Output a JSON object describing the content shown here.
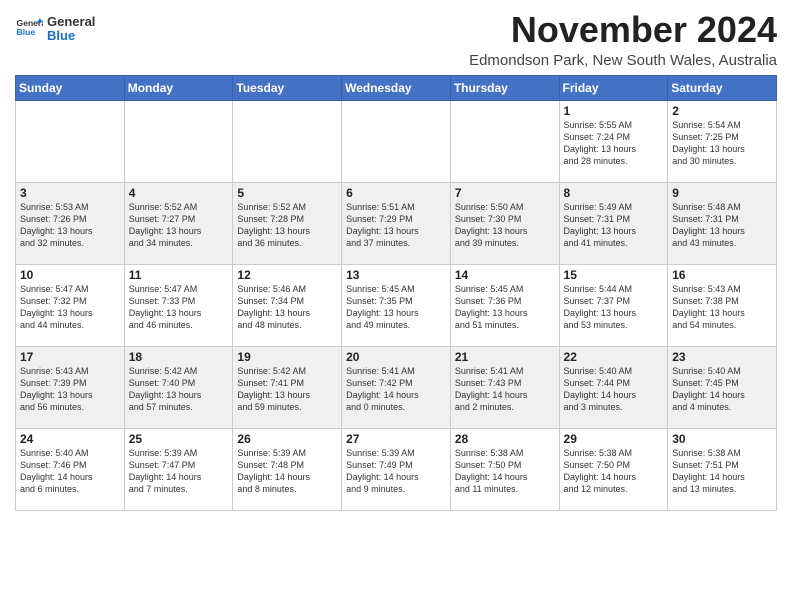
{
  "header": {
    "logo_general": "General",
    "logo_blue": "Blue",
    "month_title": "November 2024",
    "location": "Edmondson Park, New South Wales, Australia"
  },
  "days_of_week": [
    "Sunday",
    "Monday",
    "Tuesday",
    "Wednesday",
    "Thursday",
    "Friday",
    "Saturday"
  ],
  "weeks": [
    [
      {
        "day": "",
        "info": ""
      },
      {
        "day": "",
        "info": ""
      },
      {
        "day": "",
        "info": ""
      },
      {
        "day": "",
        "info": ""
      },
      {
        "day": "",
        "info": ""
      },
      {
        "day": "1",
        "info": "Sunrise: 5:55 AM\nSunset: 7:24 PM\nDaylight: 13 hours\nand 28 minutes."
      },
      {
        "day": "2",
        "info": "Sunrise: 5:54 AM\nSunset: 7:25 PM\nDaylight: 13 hours\nand 30 minutes."
      }
    ],
    [
      {
        "day": "3",
        "info": "Sunrise: 5:53 AM\nSunset: 7:26 PM\nDaylight: 13 hours\nand 32 minutes."
      },
      {
        "day": "4",
        "info": "Sunrise: 5:52 AM\nSunset: 7:27 PM\nDaylight: 13 hours\nand 34 minutes."
      },
      {
        "day": "5",
        "info": "Sunrise: 5:52 AM\nSunset: 7:28 PM\nDaylight: 13 hours\nand 36 minutes."
      },
      {
        "day": "6",
        "info": "Sunrise: 5:51 AM\nSunset: 7:29 PM\nDaylight: 13 hours\nand 37 minutes."
      },
      {
        "day": "7",
        "info": "Sunrise: 5:50 AM\nSunset: 7:30 PM\nDaylight: 13 hours\nand 39 minutes."
      },
      {
        "day": "8",
        "info": "Sunrise: 5:49 AM\nSunset: 7:31 PM\nDaylight: 13 hours\nand 41 minutes."
      },
      {
        "day": "9",
        "info": "Sunrise: 5:48 AM\nSunset: 7:31 PM\nDaylight: 13 hours\nand 43 minutes."
      }
    ],
    [
      {
        "day": "10",
        "info": "Sunrise: 5:47 AM\nSunset: 7:32 PM\nDaylight: 13 hours\nand 44 minutes."
      },
      {
        "day": "11",
        "info": "Sunrise: 5:47 AM\nSunset: 7:33 PM\nDaylight: 13 hours\nand 46 minutes."
      },
      {
        "day": "12",
        "info": "Sunrise: 5:46 AM\nSunset: 7:34 PM\nDaylight: 13 hours\nand 48 minutes."
      },
      {
        "day": "13",
        "info": "Sunrise: 5:45 AM\nSunset: 7:35 PM\nDaylight: 13 hours\nand 49 minutes."
      },
      {
        "day": "14",
        "info": "Sunrise: 5:45 AM\nSunset: 7:36 PM\nDaylight: 13 hours\nand 51 minutes."
      },
      {
        "day": "15",
        "info": "Sunrise: 5:44 AM\nSunset: 7:37 PM\nDaylight: 13 hours\nand 53 minutes."
      },
      {
        "day": "16",
        "info": "Sunrise: 5:43 AM\nSunset: 7:38 PM\nDaylight: 13 hours\nand 54 minutes."
      }
    ],
    [
      {
        "day": "17",
        "info": "Sunrise: 5:43 AM\nSunset: 7:39 PM\nDaylight: 13 hours\nand 56 minutes."
      },
      {
        "day": "18",
        "info": "Sunrise: 5:42 AM\nSunset: 7:40 PM\nDaylight: 13 hours\nand 57 minutes."
      },
      {
        "day": "19",
        "info": "Sunrise: 5:42 AM\nSunset: 7:41 PM\nDaylight: 13 hours\nand 59 minutes."
      },
      {
        "day": "20",
        "info": "Sunrise: 5:41 AM\nSunset: 7:42 PM\nDaylight: 14 hours\nand 0 minutes."
      },
      {
        "day": "21",
        "info": "Sunrise: 5:41 AM\nSunset: 7:43 PM\nDaylight: 14 hours\nand 2 minutes."
      },
      {
        "day": "22",
        "info": "Sunrise: 5:40 AM\nSunset: 7:44 PM\nDaylight: 14 hours\nand 3 minutes."
      },
      {
        "day": "23",
        "info": "Sunrise: 5:40 AM\nSunset: 7:45 PM\nDaylight: 14 hours\nand 4 minutes."
      }
    ],
    [
      {
        "day": "24",
        "info": "Sunrise: 5:40 AM\nSunset: 7:46 PM\nDaylight: 14 hours\nand 6 minutes."
      },
      {
        "day": "25",
        "info": "Sunrise: 5:39 AM\nSunset: 7:47 PM\nDaylight: 14 hours\nand 7 minutes."
      },
      {
        "day": "26",
        "info": "Sunrise: 5:39 AM\nSunset: 7:48 PM\nDaylight: 14 hours\nand 8 minutes."
      },
      {
        "day": "27",
        "info": "Sunrise: 5:39 AM\nSunset: 7:49 PM\nDaylight: 14 hours\nand 9 minutes."
      },
      {
        "day": "28",
        "info": "Sunrise: 5:38 AM\nSunset: 7:50 PM\nDaylight: 14 hours\nand 11 minutes."
      },
      {
        "day": "29",
        "info": "Sunrise: 5:38 AM\nSunset: 7:50 PM\nDaylight: 14 hours\nand 12 minutes."
      },
      {
        "day": "30",
        "info": "Sunrise: 5:38 AM\nSunset: 7:51 PM\nDaylight: 14 hours\nand 13 minutes."
      }
    ]
  ]
}
